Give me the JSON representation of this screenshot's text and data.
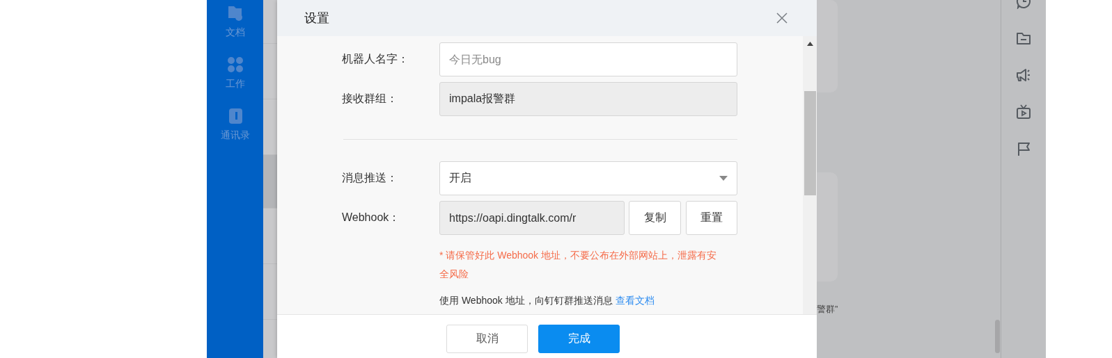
{
  "sidebar": {
    "items": [
      {
        "label": "文档",
        "kind": "docs"
      },
      {
        "label": "工作",
        "kind": "work"
      },
      {
        "label": "通讯录",
        "kind": "contacts"
      }
    ]
  },
  "background": {
    "text_fragment": "警群”"
  },
  "dialog": {
    "title": "设置",
    "fields": [
      {
        "kind": "input",
        "label": "机器人名字：",
        "placeholder": "今日无bug",
        "disabled": false
      },
      {
        "kind": "text",
        "label": "接收群组：",
        "value": "impala报警群",
        "disabled": true
      },
      {
        "kind": "divider"
      },
      {
        "kind": "select",
        "label": "消息推送：",
        "value": "开启",
        "disabled": false
      },
      {
        "kind": "webhook",
        "label": "Webhook：",
        "value": "https://oapi.dingtalk.com/r",
        "disabled": true,
        "buttons": [
          "复制",
          "重置"
        ]
      }
    ],
    "warning": "* 请保管好此 Webhook 地址，不要公布在外部网站上，泄露有安全风险",
    "usage": {
      "text": "使用 Webhook 地址，向钉钉群推送消息",
      "link": "查看文档"
    },
    "buttons": [
      {
        "label": "取消",
        "kind": "default"
      },
      {
        "label": "完成",
        "kind": "primary"
      }
    ]
  }
}
